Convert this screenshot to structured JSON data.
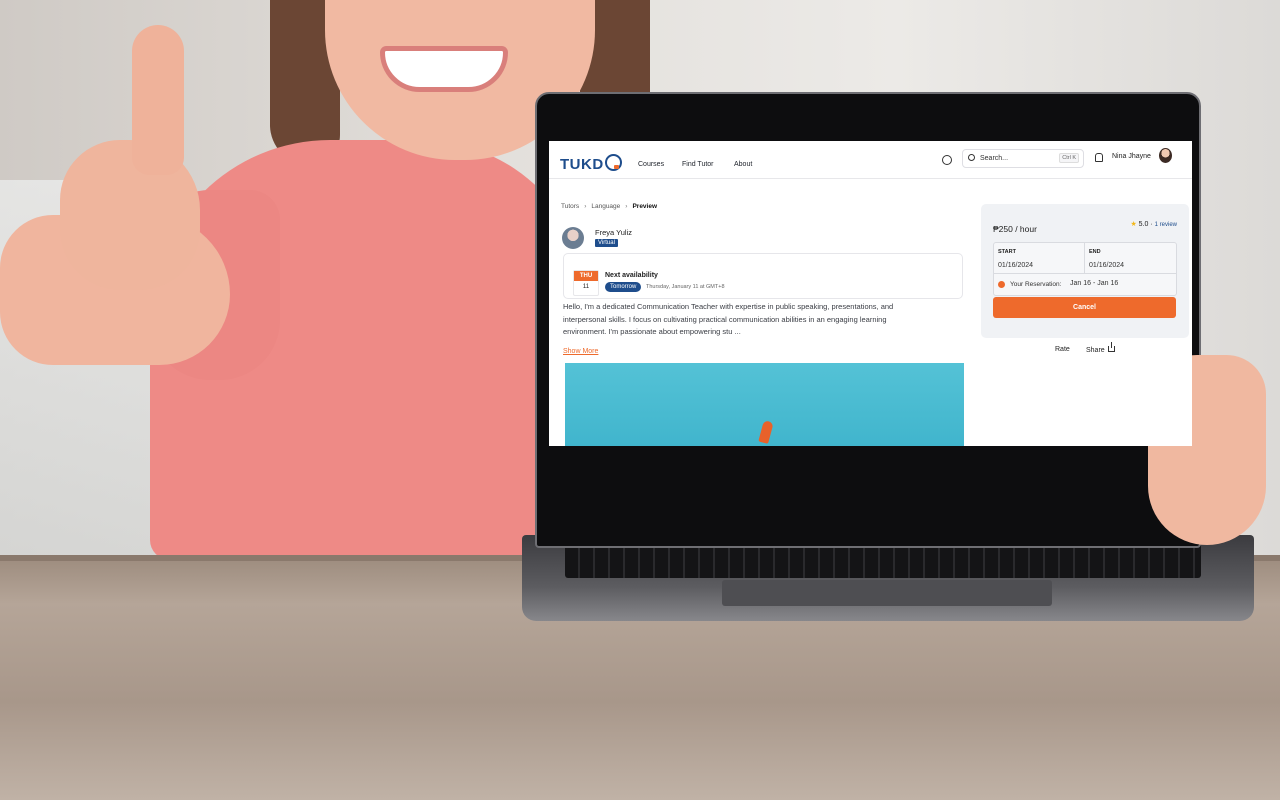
{
  "nav": {
    "logo": "TUKD",
    "links": [
      "Courses",
      "Find Tutor",
      "About"
    ],
    "search_placeholder": "Search...",
    "search_shortcut": "Ctrl K",
    "user_name": "Nina Jhayne"
  },
  "breadcrumb": [
    "Tutors",
    "Language",
    "Preview"
  ],
  "tutor": {
    "name": "Freya Yuliz",
    "badge": "Virtual"
  },
  "availability": {
    "day_abbr": "THU",
    "day_num": "11",
    "title": "Next availability",
    "pill": "Tomorrow",
    "detail": "Thursday, January 11 at GMT+8"
  },
  "description": "Hello, I'm a dedicated Communication Teacher with expertise in public speaking, presentations, and interpersonal skills. I focus on cultivating practical communication abilities in an engaging learning environment. I'm passionate about empowering stu ...",
  "show_more": "Show More",
  "booking": {
    "price": "₱250 / hour",
    "rating": "5.0",
    "reviews": "1 review",
    "start_label": "START",
    "start_value": "01/16/2024",
    "end_label": "END",
    "end_value": "01/16/2024",
    "reservation_label": "Your Reservation:",
    "reservation_value": "Jan 16  -  Jan 16",
    "cancel_label": "Cancel",
    "rate_label": "Rate",
    "share_label": "Share"
  },
  "colors": {
    "brand_blue": "#1e4d8c",
    "accent_orange": "#ee6a2c"
  }
}
